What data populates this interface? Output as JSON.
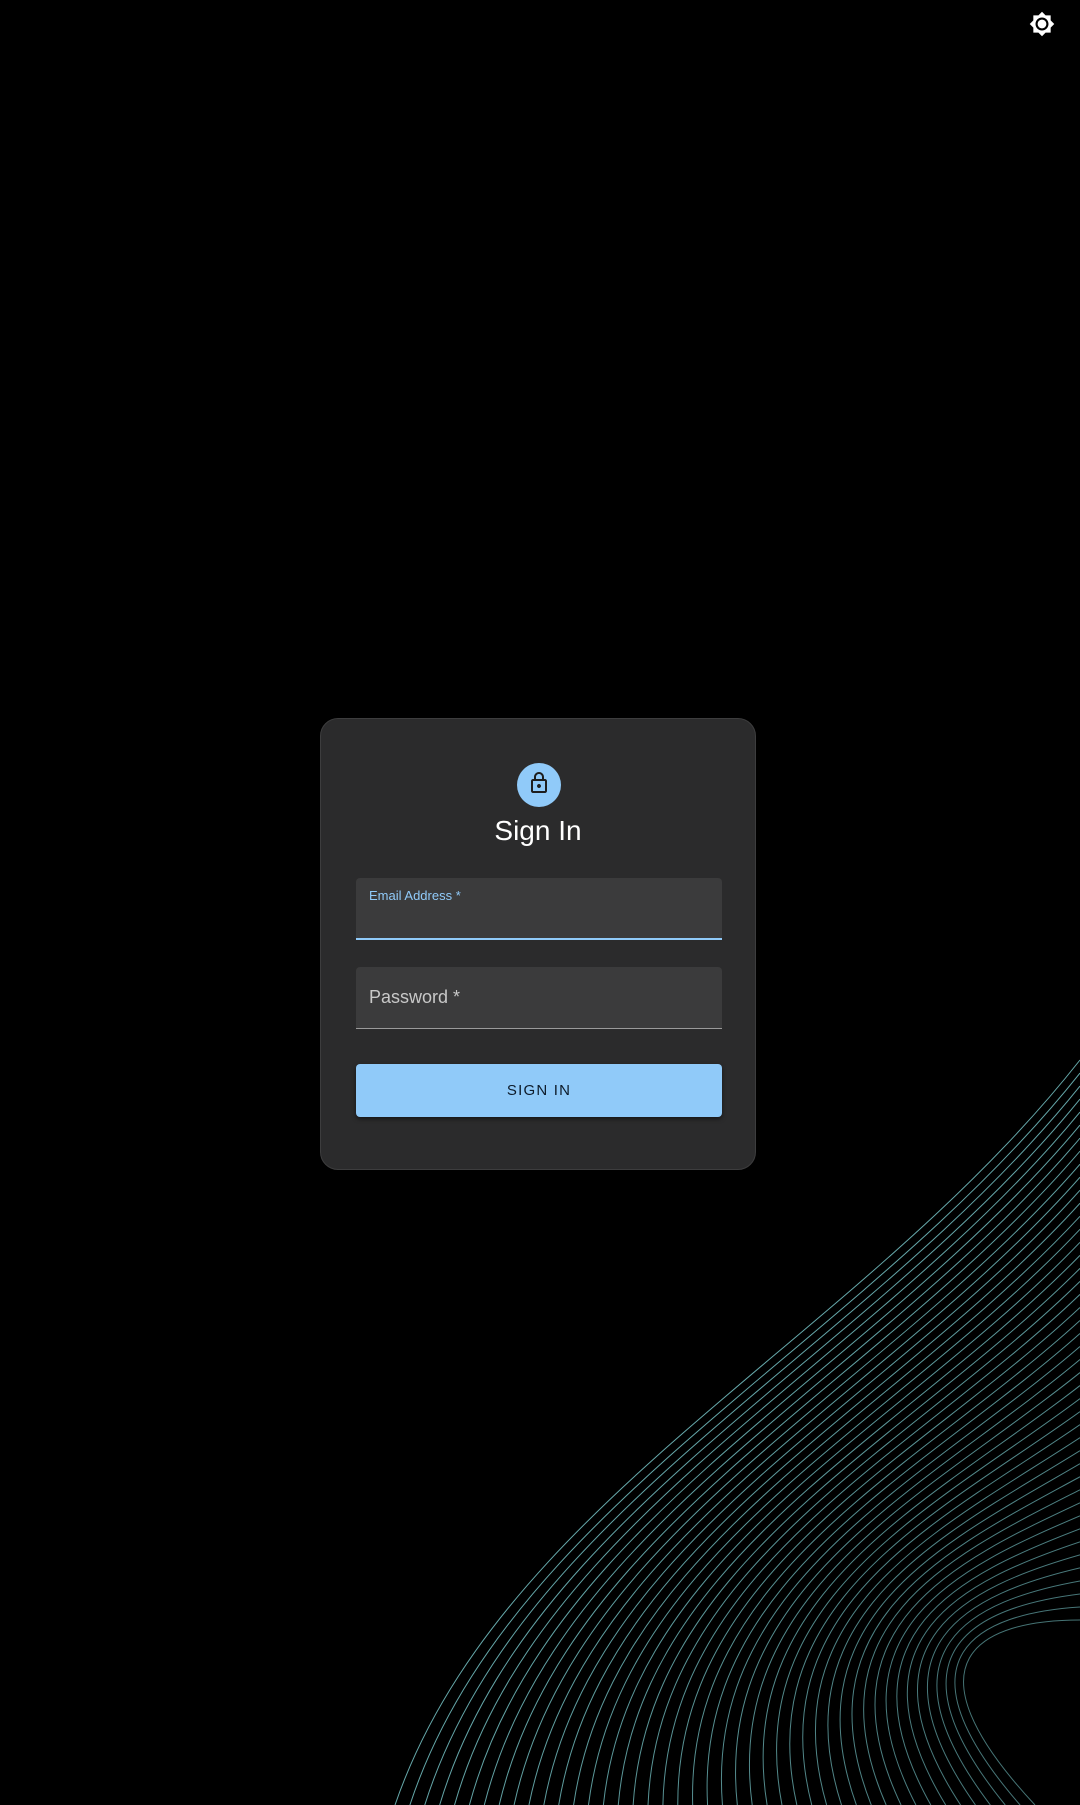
{
  "header": {
    "theme_toggle_icon": "brightness-icon"
  },
  "login": {
    "avatar_icon": "lock-icon",
    "title": "Sign In",
    "email": {
      "label": "Email Address *",
      "value": ""
    },
    "password": {
      "label": "Password *",
      "value": ""
    },
    "submit_label": "SIGN IN"
  },
  "colors": {
    "background": "#000000",
    "card": "#2b2b2c",
    "field": "#3b3b3c",
    "accent": "#90caf9",
    "wave_lines": "#7fd3d6"
  }
}
